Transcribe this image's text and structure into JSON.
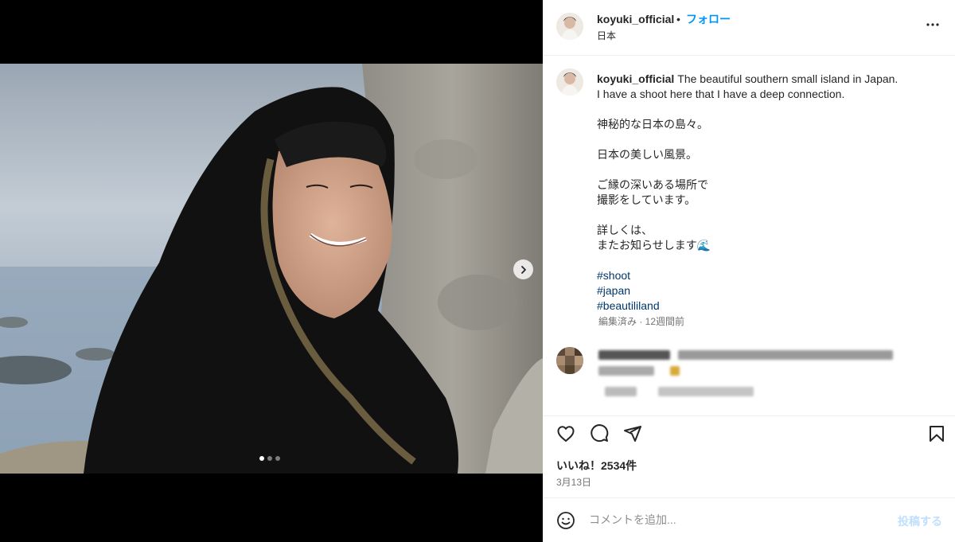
{
  "post": {
    "username": "koyuki_official",
    "follow_label": "フォロー",
    "separator": "•",
    "location": "日本",
    "caption_lines": [
      "The beautiful southern small island in Japan.",
      "I have a shoot here that I have a deep connection."
    ],
    "caption_jp": [
      "神秘的な日本の島々。",
      "日本の美しい風景。",
      "ご縁の深いある場所で",
      "撮影をしています。",
      "詳しくは、",
      "またお知らせします🌊"
    ],
    "hashtags": [
      "#shoot",
      "#japan",
      "#beautililand"
    ],
    "meta": "編集済み · 12週間前",
    "likes": "いいね！2534件",
    "date": "3月13日",
    "comment_placeholder": "コメントを追加...",
    "post_label": "投稿する"
  },
  "media": {
    "slide_count": 3,
    "active_slide": 1
  },
  "icons": {
    "more": "more-horizontal-icon",
    "like": "heart-icon",
    "comment": "comment-icon",
    "share": "send-icon",
    "save": "bookmark-icon",
    "emoji": "emoji-icon",
    "next": "chevron-right-icon"
  },
  "colors": {
    "accent": "#0095f6",
    "hashtag": "#00376b",
    "muted": "#737373"
  }
}
